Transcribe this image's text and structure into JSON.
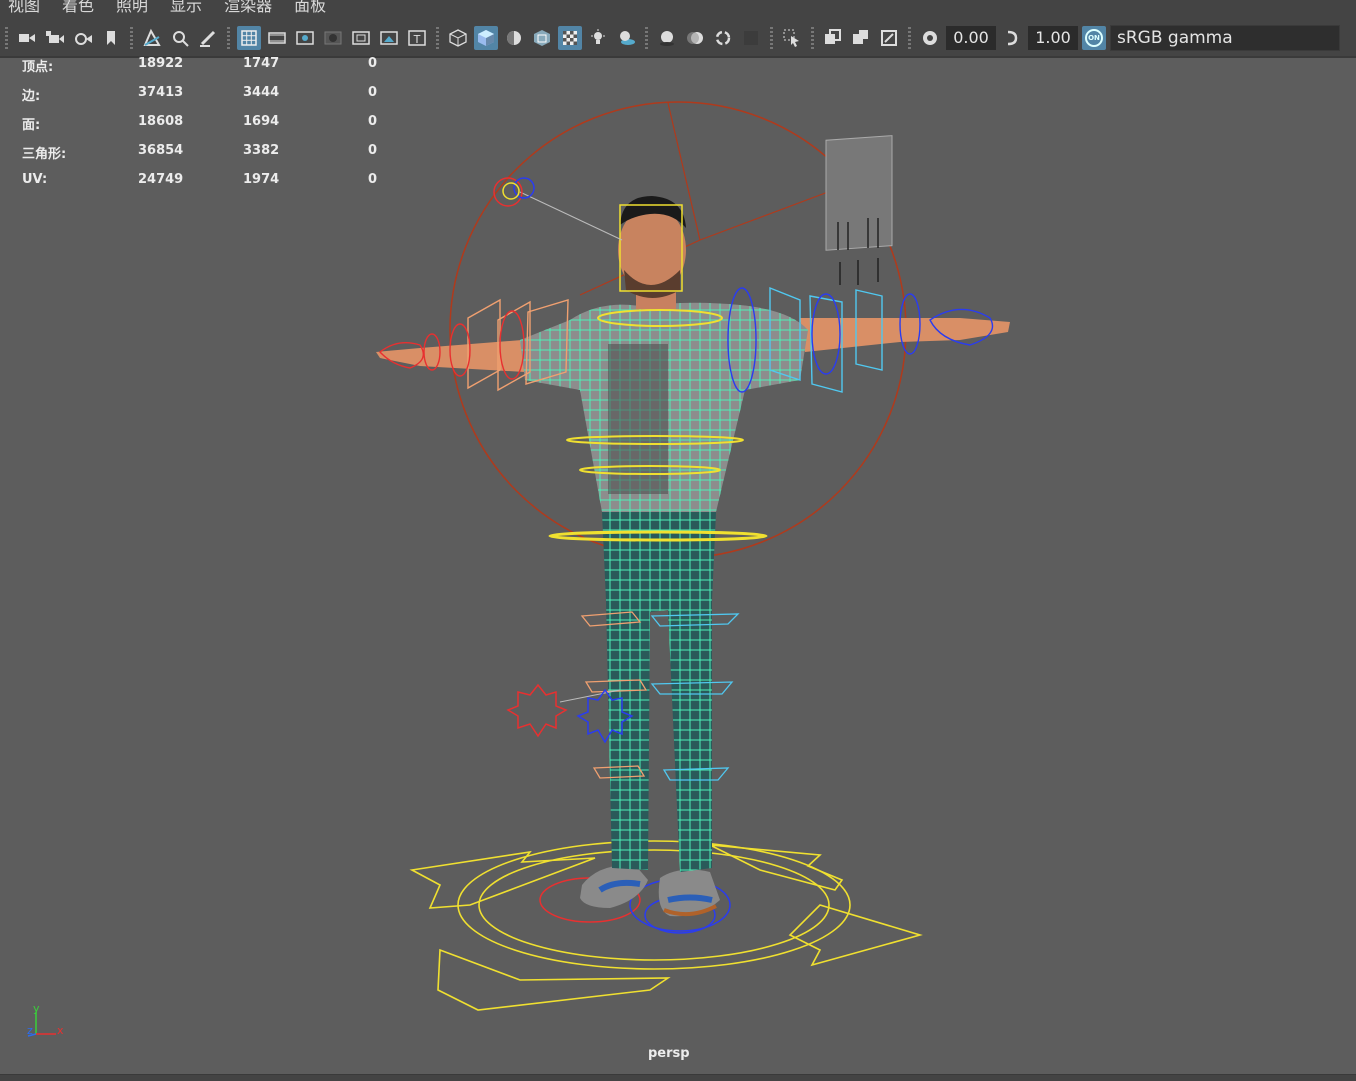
{
  "menu": [
    "视图",
    "着色",
    "照明",
    "显示",
    "渲染器",
    "面板"
  ],
  "toolbar": {
    "icons": [
      "select-camera-icon",
      "camera-attributes-icon",
      "camera-lock-icon",
      "bookmark-icon",
      "image-plane-icon",
      "2d-pan-zoom-icon",
      "grease-pencil-icon",
      "grid-icon",
      "film-gate-icon",
      "resolution-gate-icon",
      "gate-mask-icon",
      "field-chart-icon",
      "safe-action-icon",
      "safe-title-icon",
      "wireframe-icon",
      "smooth-shade-icon",
      "default-material-icon",
      "bounding-box-icon",
      "textured-icon",
      "use-lights-icon",
      "shadows-icon",
      "screen-space-ao-icon",
      "motion-blur-icon",
      "anti-alias-icon",
      "depth-of-field-icon",
      "isolate-select-icon",
      "xray-icon",
      "xray-active-components-icon",
      "xray-joints-icon",
      "exposure-icon",
      "gamma-icon",
      "view-transform-icon"
    ],
    "exposure_value": "0.00",
    "gamma_value": "1.00",
    "color_management_badge": "ON",
    "color_space": "sRGB gamma"
  },
  "hud": {
    "rows": [
      {
        "label": "顶点:",
        "a": "18922",
        "b": "1747",
        "c": "0"
      },
      {
        "label": "边:",
        "a": "37413",
        "b": "3444",
        "c": "0"
      },
      {
        "label": "面:",
        "a": "18608",
        "b": "1694",
        "c": "0"
      },
      {
        "label": "三角形:",
        "a": "36854",
        "b": "3382",
        "c": "0"
      },
      {
        "label": "UV:",
        "a": "24749",
        "b": "1974",
        "c": "0"
      }
    ]
  },
  "viewport": {
    "camera_name": "persp",
    "axis_labels": {
      "x": "x",
      "y": "y",
      "z": "z"
    },
    "colors": {
      "background": "#5d5d5d",
      "mesh_wire": "#4ef0b8",
      "ctrl_left": "#e83030",
      "ctrl_right": "#2a3cf0",
      "ctrl_center": "#f0e030",
      "ctrl_orange": "#f0a070",
      "ctrl_cyan": "#50c8f0",
      "rig_circle": "#b03a1c",
      "skin": "#d98f66"
    }
  }
}
